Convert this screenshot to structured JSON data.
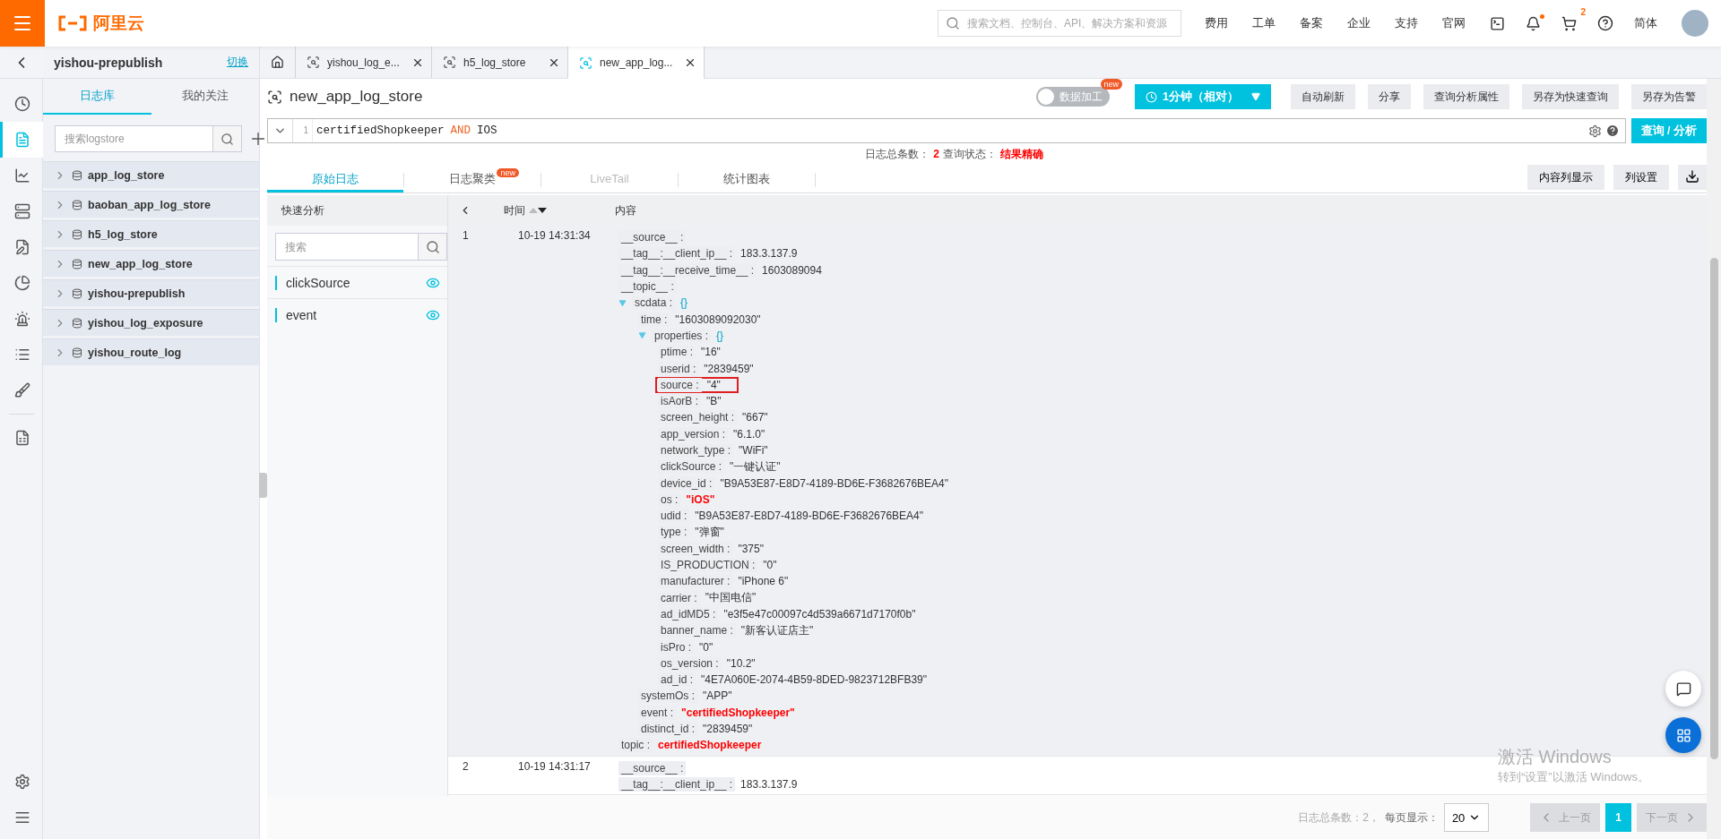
{
  "topbar": {
    "logo": "阿里云",
    "search": {
      "placeholder": "搜索文档、控制台、API、解决方案和资源"
    },
    "links": [
      "费用",
      "工单",
      "备案",
      "企业",
      "支持",
      "官网"
    ],
    "bell_dot": true,
    "cart_badge": "2",
    "language": "简体"
  },
  "project": {
    "name": "yishou-prepublish",
    "switch": "切换"
  },
  "tabs": [
    {
      "kind": "home",
      "selected": false
    },
    {
      "label": "yishou_log_e...",
      "kind": "page",
      "selected": false
    },
    {
      "label": "h5_log_store",
      "kind": "page",
      "selected": false
    },
    {
      "label": "new_app_log...",
      "kind": "page",
      "selected": true
    }
  ],
  "rail": [
    {
      "selected": false
    },
    {
      "selected": true
    },
    {
      "selected": false
    },
    {
      "selected": false
    },
    {
      "selected": false
    },
    {
      "selected": false
    },
    {
      "selected": false
    },
    {
      "selected": false
    },
    {
      "selected": false
    },
    {
      "selected": false
    }
  ],
  "store_panel": {
    "tabs": [
      {
        "label": "日志库",
        "selected": true
      },
      {
        "label": "我的关注",
        "selected": false
      }
    ],
    "search": {
      "placeholder": "搜索logstore"
    },
    "stores": [
      "app_log_store",
      "baoban_app_log_store",
      "h5_log_store",
      "new_app_log_store",
      "yishou-prepublish",
      "yishou_log_exposure",
      "yishou_route_log"
    ]
  },
  "main": {
    "title": "new_app_log_store",
    "processing": {
      "label": "数据加工",
      "badge": "new",
      "on": false
    },
    "time_range": "1分钟（相对）",
    "actions": [
      "自动刷新",
      "分享",
      "查询分析属性",
      "另存为快速查询",
      "另存为告警"
    ],
    "query": {
      "line": "1",
      "tokens": [
        {
          "text": "certifiedShopkeeper",
          "kind": "term"
        },
        {
          "text": "AND",
          "kind": "keyword"
        },
        {
          "text": "IOS",
          "kind": "term"
        }
      ]
    },
    "submit": "查询 / 分析",
    "status": {
      "count_label": "日志总条数：",
      "count": "2",
      "state_label": "查询状态：",
      "state": "结果精确"
    },
    "view_tabs": [
      {
        "label": "原始日志",
        "selected": true,
        "disabled": false
      },
      {
        "label": "日志聚类",
        "badge": "new",
        "selected": false,
        "disabled": false
      },
      {
        "label": "LiveTail",
        "selected": false,
        "disabled": true
      },
      {
        "label": "统计图表",
        "selected": false,
        "disabled": false
      }
    ],
    "view_buttons": [
      "内容列显示",
      "列设置"
    ],
    "quick": {
      "title": "快速分析",
      "search": {
        "placeholder": "搜索"
      },
      "fields": [
        "clickSource",
        "event"
      ]
    },
    "columns": [
      "时间",
      "内容"
    ],
    "rows": [
      {
        "number": "1",
        "time": "10-19 14:31:34",
        "highlighted": true,
        "fields": [
          {
            "key": "__source__ :"
          },
          {
            "key": "__tag__:__client_ip__ :",
            "value": "183.3.137.9",
            "kind": "text"
          },
          {
            "key": "__tag__:__receive_time__ :",
            "value": "1603089094",
            "kind": "text"
          },
          {
            "key": "__topic__ :"
          },
          {
            "key": "scdata :",
            "value": "{}",
            "kind": "object",
            "expanded": true,
            "children": [
              {
                "key": "time :",
                "value": "\"1603089092030\"",
                "kind": "text"
              },
              {
                "key": "properties :",
                "value": "{}",
                "kind": "object",
                "expanded": true,
                "children": [
                  {
                    "key": "ptime :",
                    "value": "\"16\"",
                    "kind": "text"
                  },
                  {
                    "key": "userid :",
                    "value": "\"2839459\"",
                    "kind": "text"
                  },
                  {
                    "key": "source :",
                    "value": "\"4\"",
                    "kind": "text",
                    "boxed": true
                  },
                  {
                    "key": "isAorB :",
                    "value": "\"B\"",
                    "kind": "text"
                  },
                  {
                    "key": "screen_height :",
                    "value": "\"667\"",
                    "kind": "text"
                  },
                  {
                    "key": "app_version :",
                    "value": "\"6.1.0\"",
                    "kind": "text"
                  },
                  {
                    "key": "network_type :",
                    "value": "\"WiFi\"",
                    "kind": "text"
                  },
                  {
                    "key": "clickSource :",
                    "value": "\"一键认证\"",
                    "kind": "text"
                  },
                  {
                    "key": "device_id :",
                    "value": "\"B9A53E87-E8D7-4189-BD6E-F3682676BEA4\"",
                    "kind": "text"
                  },
                  {
                    "key": "os :",
                    "value": "\"iOS\"",
                    "kind": "highlight"
                  },
                  {
                    "key": "udid :",
                    "value": "\"B9A53E87-E8D7-4189-BD6E-F3682676BEA4\"",
                    "kind": "text"
                  },
                  {
                    "key": "type :",
                    "value": "\"弹窗\"",
                    "kind": "text"
                  },
                  {
                    "key": "screen_width :",
                    "value": "\"375\"",
                    "kind": "text"
                  },
                  {
                    "key": "IS_PRODUCTION :",
                    "value": "\"0\"",
                    "kind": "text"
                  },
                  {
                    "key": "manufacturer :",
                    "value": "\"iPhone 6\"",
                    "kind": "text"
                  },
                  {
                    "key": "carrier :",
                    "value": "\"中国电信\"",
                    "kind": "text"
                  },
                  {
                    "key": "ad_idMD5 :",
                    "value": "\"e3f5e47c00097c4d539a6671d7170f0b\"",
                    "kind": "text"
                  },
                  {
                    "key": "banner_name :",
                    "value": "\"新客认证店主\"",
                    "kind": "text"
                  },
                  {
                    "key": "isPro :",
                    "value": "\"0\"",
                    "kind": "text"
                  },
                  {
                    "key": "os_version :",
                    "value": "\"10.2\"",
                    "kind": "text"
                  },
                  {
                    "key": "ad_id :",
                    "value": "\"4E7A060E-2074-4B59-8DED-9823712BFB39\"",
                    "kind": "text"
                  }
                ]
              },
              {
                "key": "systemOs :",
                "value": "\"APP\"",
                "kind": "text"
              },
              {
                "key": "event :",
                "value": "\"certifiedShopkeeper\"",
                "kind": "highlight"
              },
              {
                "key": "distinct_id :",
                "value": "\"2839459\"",
                "kind": "text"
              }
            ]
          },
          {
            "key": "topic :",
            "value": "certifiedShopkeeper",
            "kind": "highlight"
          }
        ]
      },
      {
        "number": "2",
        "time": "10-19 14:31:17",
        "highlighted": false,
        "fields": [
          {
            "key": "__source__ :"
          },
          {
            "key": "__tag__:__client_ip__ :",
            "value": "183.3.137.9",
            "kind": "text"
          }
        ]
      }
    ],
    "pagination": {
      "total": "日志总条数：2，",
      "per_page_label": "每页显示：",
      "per_page": "20",
      "prev": "上一页",
      "pages": [
        {
          "label": "1",
          "selected": true
        }
      ],
      "next": "下一页",
      "prev_disabled": true,
      "next_disabled": true
    }
  },
  "activation_notice": {
    "title": "激活 Windows",
    "subtitle": "转到“设置”以激活 Windows。"
  }
}
